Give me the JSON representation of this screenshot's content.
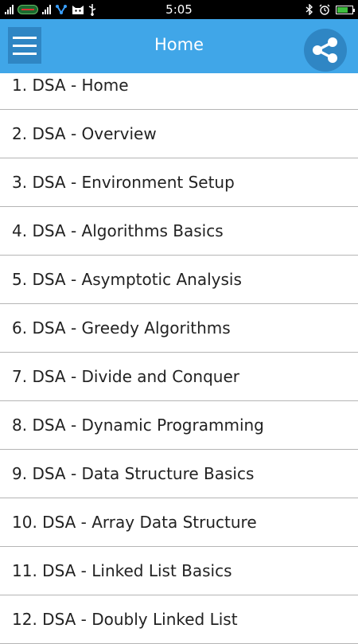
{
  "status_bar": {
    "time": "5:05",
    "icons_left": [
      "signal-icon",
      "carrier-icon",
      "signal-icon",
      "network-icon",
      "cat-icon",
      "usb-icon"
    ],
    "icons_right": [
      "bluetooth-icon",
      "alarm-icon",
      "battery-charging-icon"
    ]
  },
  "app_bar": {
    "title": "Home",
    "background": "#40a6e8",
    "button_color": "#2f86c4"
  },
  "list": {
    "items": [
      "1. DSA - Home",
      "2. DSA - Overview",
      "3. DSA - Environment Setup",
      "4. DSA - Algorithms Basics",
      "5. DSA - Asymptotic Analysis",
      "6. DSA - Greedy Algorithms",
      "7. DSA - Divide and Conquer",
      "8. DSA - Dynamic Programming",
      "9. DSA - Data Structure Basics",
      "10. DSA - Array Data Structure",
      "11. DSA - Linked List Basics",
      "12. DSA - Doubly Linked List"
    ]
  }
}
